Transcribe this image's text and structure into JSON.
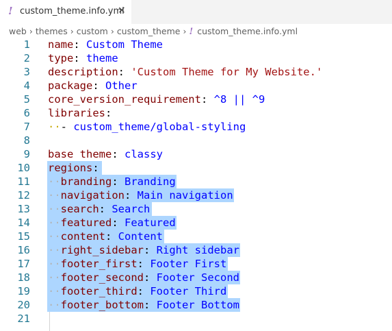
{
  "tab": {
    "icon": "!",
    "icon_name": "yaml-file-icon",
    "title": "custom_theme.info.yml",
    "close": "×"
  },
  "breadcrumbs": {
    "items": [
      "web",
      "themes",
      "custom",
      "custom_theme"
    ],
    "file_icon": "!",
    "file": "custom_theme.info.yml",
    "separator": "›"
  },
  "editor": {
    "lines": [
      {
        "num": "1",
        "key": "name",
        "value": "Custom Theme"
      },
      {
        "num": "2",
        "key": "type",
        "value": "theme"
      },
      {
        "num": "3",
        "key": "description",
        "value": "'Custom Theme for My Website.'"
      },
      {
        "num": "4",
        "key": "package",
        "value": "Other"
      },
      {
        "num": "5",
        "key": "core_version_requirement",
        "value": "^8 || ^9"
      },
      {
        "num": "6",
        "key": "libraries",
        "value": ""
      },
      {
        "num": "7",
        "key": "",
        "value": "custom_theme/global-styling"
      },
      {
        "num": "8",
        "key": "",
        "value": ""
      },
      {
        "num": "9",
        "key": "base theme",
        "value": "classy"
      },
      {
        "num": "10",
        "key": "regions",
        "value": ""
      },
      {
        "num": "11",
        "key": "branding",
        "value": "Branding"
      },
      {
        "num": "12",
        "key": "navigation",
        "value": "Main navigation"
      },
      {
        "num": "13",
        "key": "search",
        "value": "Search"
      },
      {
        "num": "14",
        "key": "featured",
        "value": "Featured"
      },
      {
        "num": "15",
        "key": "content",
        "value": "Content"
      },
      {
        "num": "16",
        "key": "right_sidebar",
        "value": "Right sidebar"
      },
      {
        "num": "17",
        "key": "footer_first",
        "value": "Footer First"
      },
      {
        "num": "18",
        "key": "footer_second",
        "value": "Footer Second"
      },
      {
        "num": "19",
        "key": "footer_third",
        "value": "Footer Third"
      },
      {
        "num": "20",
        "key": "footer_bottom",
        "value": "Footer Bottom"
      },
      {
        "num": "21",
        "key": "",
        "value": ""
      }
    ],
    "selection_lines": "10-20",
    "colors": {
      "key": "#800000",
      "value": "#0000ff",
      "string": "#a31515",
      "line_number": "#237893",
      "selection": "#add6ff"
    }
  }
}
